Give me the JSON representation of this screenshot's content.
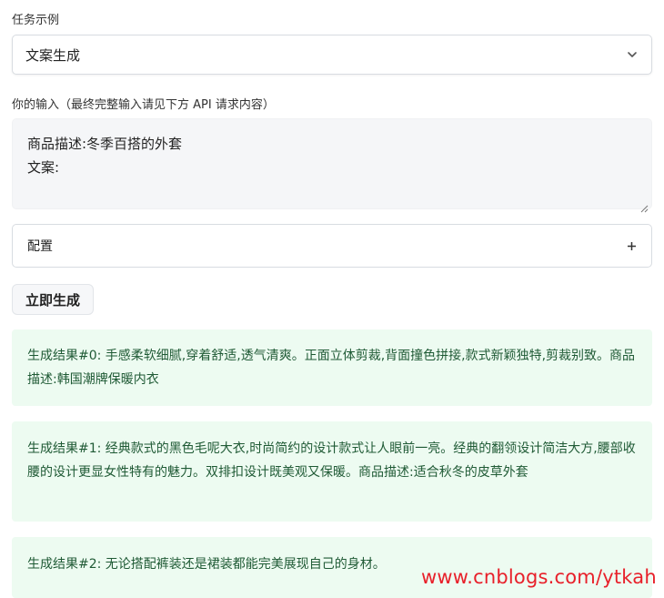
{
  "task_example": {
    "label": "任务示例",
    "selected": "文案生成",
    "chevron_icon": "chevron-down-icon"
  },
  "input": {
    "label": "你的输入（最终完整输入请见下方 API 请求内容）",
    "lines": [
      "商品描述:冬季百搭的外套",
      "文案:"
    ]
  },
  "config": {
    "label": "配置",
    "expand_icon": "plus-icon"
  },
  "generate_button": "立即生成",
  "results": [
    "生成结果#0: 手感柔软细腻,穿着舒适,透气清爽。正面立体剪裁,背面撞色拼接,款式新颖独特,剪裁别致。商品描述:韩国潮牌保暖内衣",
    "生成结果#1: 经典款式的黑色毛呢大衣,时尚简约的设计款式让人眼前一亮。经典的翻领设计简洁大方,腰部收腰的设计更显女性特有的魅力。双排扣设计既美观又保暖。商品描述:适合秋冬的皮草外套",
    "生成结果#2: 无论搭配裤装还是裙装都能完美展现自己的身材。"
  ],
  "watermark": "www.cnblogs.com/ytkah",
  "colors": {
    "result_bg": "#edfbf1",
    "result_text": "#1f5a35",
    "watermark": "#e8202a"
  }
}
